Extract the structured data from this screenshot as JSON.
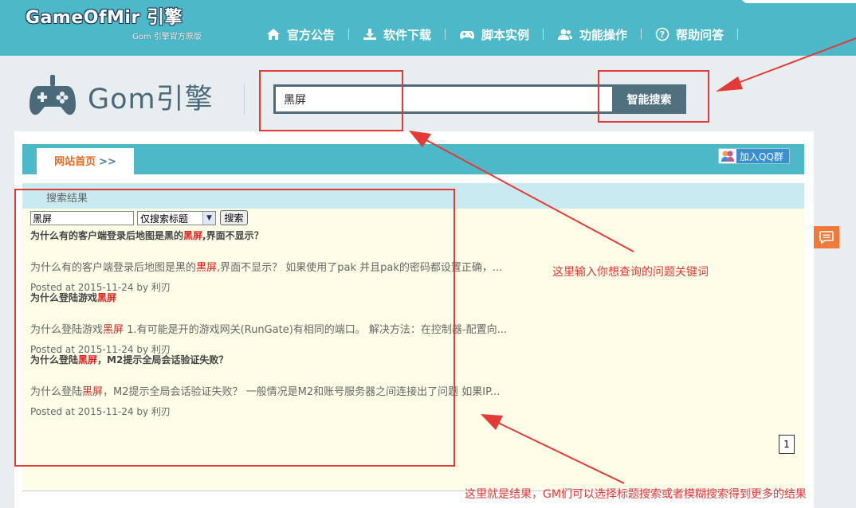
{
  "brand": {
    "title": "GameOfMir 引擎",
    "subtitle": "Gom 引擎官方原版"
  },
  "nav": [
    {
      "label": "官方公告",
      "icon": "home-icon"
    },
    {
      "label": "软件下载",
      "icon": "download-icon"
    },
    {
      "label": "脚本实例",
      "icon": "gamepad-icon"
    },
    {
      "label": "功能操作",
      "icon": "users-icon"
    },
    {
      "label": "帮助问答",
      "icon": "help-icon"
    }
  ],
  "logo": {
    "text": "Gom引擎",
    "icon": "gamepad-icon"
  },
  "search": {
    "value": "黑屏",
    "button_label": "智能搜索"
  },
  "breadcrumb": {
    "home_label": "网站首页",
    "separator": ">>"
  },
  "qq_button": {
    "label": "加入QQ群",
    "icon": "qq-group-icon"
  },
  "results": {
    "heading": "搜索结果",
    "mini_search": {
      "value": "黑屏",
      "scope": "仅搜索标题",
      "button_label": "搜索"
    },
    "items": [
      {
        "title_parts": [
          "为什么有的客户端登录后地图是黑的",
          "黑屏",
          ",界面不显示？"
        ],
        "excerpt_parts": [
          "为什么有的客户端登录后地图是黑的",
          "黑屏",
          ",界面不显示？ 如果使用了pak 并且pak的密码都设置正确，..."
        ],
        "meta": "Posted at 2015-11-24 by 利刃"
      },
      {
        "title_parts": [
          "为什么登陆游戏",
          "黑屏",
          ""
        ],
        "excerpt_parts": [
          "为什么登陆游戏",
          "黑屏",
          " 1.有可能是开的游戏网关(RunGate)有相同的端口。 解决方法：在控制器-配置向..."
        ],
        "meta": "Posted at 2015-11-24 by 利刃"
      },
      {
        "title_parts": [
          "为什么登陆",
          "黑屏",
          "，M2提示全局会话验证失败？"
        ],
        "excerpt_parts": [
          "为什么登陆",
          "黑屏",
          "，M2提示全局会话验证失败？ 一般情况是M2和账号服务器之间连接出了问题 如果IP..."
        ],
        "meta": "Posted at 2015-11-24 by 利刃"
      }
    ],
    "page": "1"
  },
  "annotations": {
    "keyword_hint": "这里输入你想查询的问题关键词",
    "result_hint": "这里就是结果，GM们可以选择标题搜索或者模糊搜索得到更多的结果"
  },
  "colors": {
    "header": "#4cb8c8",
    "accent": "#e86a1a",
    "annotation": "#e53935",
    "search_button": "#50707e"
  }
}
